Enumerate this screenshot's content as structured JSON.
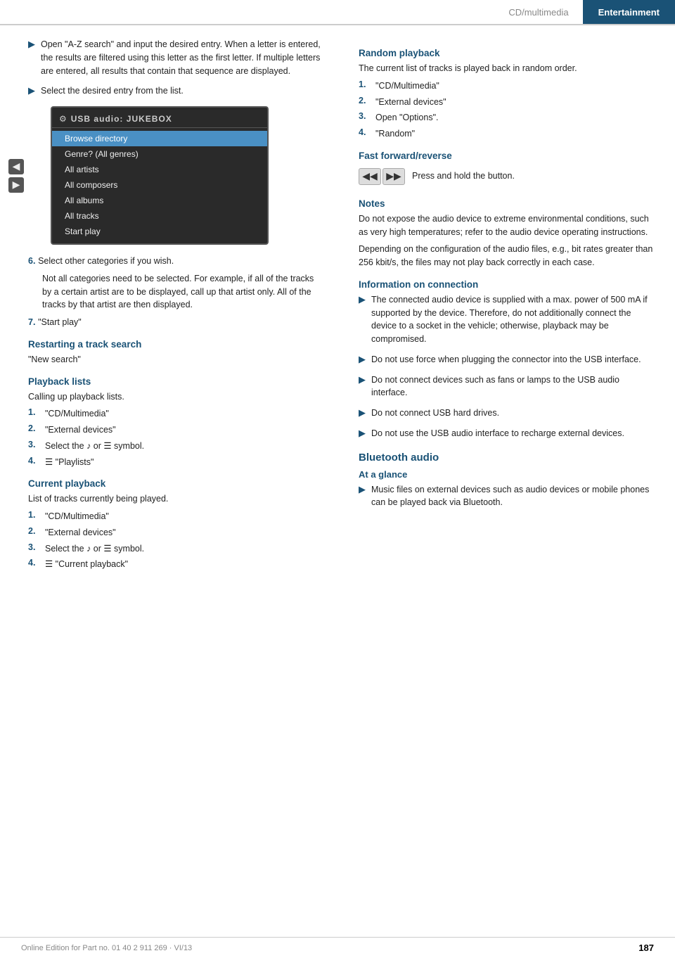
{
  "header": {
    "cd_label": "CD/multimedia",
    "entertainment_label": "Entertainment"
  },
  "left": {
    "bullet1": "Open \"A-Z search\" and input the desired entry. When a letter is entered, the results are filtered using this letter as the first letter. If multiple letters are entered, all results that contain that sequence are displayed.",
    "bullet2": "Select the desired entry from the list.",
    "usb_menu": {
      "title": "USB audio: JUKEBOX",
      "items": [
        "Browse directory",
        "Genre? (All genres)",
        "All artists",
        "All composers",
        "All albums",
        "All tracks",
        "Start play"
      ],
      "active_index": 0
    },
    "step6_label": "6.",
    "step6_text": "Select other categories if you wish.",
    "step6_indent": "Not all categories need to be selected. For example, if all of the tracks by a certain artist are to be displayed, call up that artist only. All of the tracks by that artist are then displayed.",
    "step7_label": "7.",
    "step7_text": "\"Start play\"",
    "restarting_heading": "Restarting a track search",
    "restarting_text": "\"New search\"",
    "playback_heading": "Playback lists",
    "playback_subtext": "Calling up playback lists.",
    "playback_steps": [
      {
        "num": "1.",
        "text": "\"CD/Multimedia\""
      },
      {
        "num": "2.",
        "text": "\"External devices\""
      },
      {
        "num": "3.",
        "text": "Select the  ♪  or  ☰  symbol."
      },
      {
        "num": "4.",
        "text": "♪̈  \"Playlists\""
      }
    ],
    "current_heading": "Current playback",
    "current_subtext": "List of tracks currently being played.",
    "current_steps": [
      {
        "num": "1.",
        "text": "\"CD/Multimedia\""
      },
      {
        "num": "2.",
        "text": "\"External devices\""
      },
      {
        "num": "3.",
        "text": "Select the  ♪  or  ☰  symbol."
      },
      {
        "num": "4.",
        "text": "☰  \"Current playback\""
      }
    ]
  },
  "right": {
    "random_heading": "Random playback",
    "random_subtext": "The current list of tracks is played back in random order.",
    "random_steps": [
      {
        "num": "1.",
        "text": "\"CD/Multimedia\""
      },
      {
        "num": "2.",
        "text": "\"External devices\""
      },
      {
        "num": "3.",
        "text": "Open \"Options\"."
      },
      {
        "num": "4.",
        "text": "\"Random\""
      }
    ],
    "ff_heading": "Fast forward/reverse",
    "ff_text": "Press and hold the button.",
    "notes_heading": "Notes",
    "notes_text": "Do not expose the audio device to extreme environmental conditions, such as very high temperatures; refer to the audio device operating instructions.",
    "notes_text2": "Depending on the configuration of the audio files, e.g., bit rates greater than 256 kbit/s, the files may not play back correctly in each case.",
    "info_heading": "Information on connection",
    "info_bullets": [
      "The connected audio device is supplied with a max. power of 500 mA if supported by the device. Therefore, do not additionally connect the device to a socket in the vehicle; otherwise, playback may be compromised.",
      "Do not use force when plugging the connector into the USB interface.",
      "Do not connect devices such as fans or lamps to the USB audio interface.",
      "Do not connect USB hard drives.",
      "Do not use the USB audio interface to recharge external devices."
    ],
    "bluetooth_heading": "Bluetooth audio",
    "at_a_glance_heading": "At a glance",
    "bluetooth_bullet": "Music files on external devices such as audio devices or mobile phones can be played back via Bluetooth."
  },
  "footer": {
    "text": "Online Edition for Part no. 01 40 2 911 269 · VI/13",
    "page": "187"
  }
}
